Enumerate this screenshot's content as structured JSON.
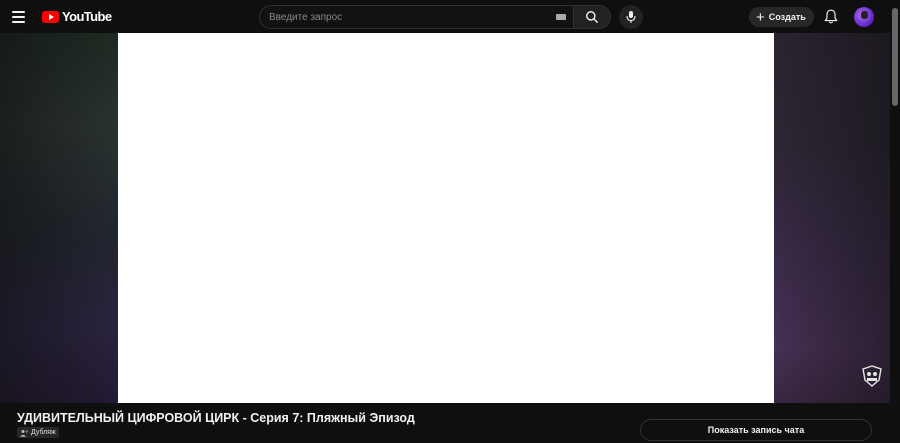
{
  "header": {
    "logo_text": "YouTube",
    "search": {
      "placeholder": "Введите запрос",
      "value": ""
    },
    "create_label": "Создать"
  },
  "icons": {
    "menu": "menu-icon",
    "search": "search-icon",
    "keyboard": "keyboard-icon",
    "mic": "microphone-icon",
    "create": "plus-icon",
    "bell": "bell-icon",
    "avatar": "avatar-image",
    "watermark": "channel-watermark-icon"
  },
  "colors": {
    "background": "#0f0f0f",
    "brand_red": "#ff0000",
    "video_frame": "#ffffff"
  },
  "video": {
    "title": "УДИВИТЕЛЬНЫЙ ЦИФРОВОЙ ЦИРК - Серия 7: Пляжный Эпизод",
    "badge": "Дубляж"
  },
  "chat": {
    "show_replay_label": "Показать запись чата"
  }
}
